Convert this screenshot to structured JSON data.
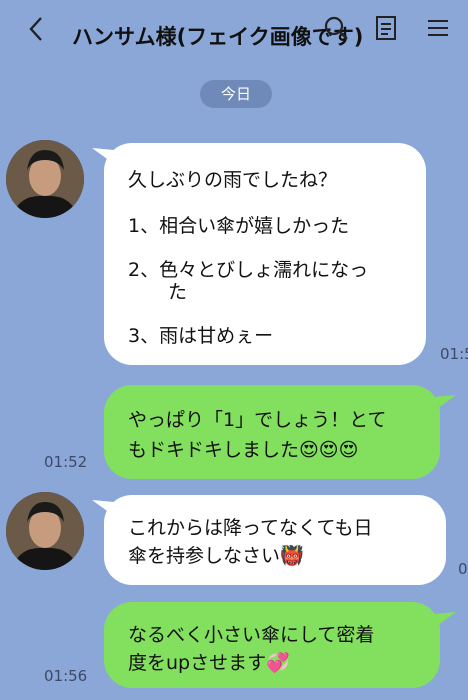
{
  "header": {
    "title": "ハンサム様(フェイク画像です)",
    "back_icon": "chevron-left-icon",
    "search_icon": "search-icon",
    "notes_icon": "notes-icon",
    "menu_icon": "menu-icon"
  },
  "date_label": "今日",
  "messages": [
    {
      "side": "left",
      "lines": [
        "久しぶりの雨でしたね？",
        "1、相合い傘が嬉しかった",
        "2、色々とびしょ濡れになっ",
        "た",
        "3、雨は甘めぇー"
      ],
      "time": "01:5"
    },
    {
      "side": "right",
      "lines": [
        "やっぱり「1」でしょう！とて",
        "もドキドキしました😍😍😍"
      ],
      "time": "01:52"
    },
    {
      "side": "left",
      "lines": [
        "これからは降ってなくても日",
        "傘を持参しなさい👹"
      ],
      "time": "0"
    },
    {
      "side": "right",
      "lines": [
        "なるべく小さい傘にして密着",
        "度をupさせます💞"
      ],
      "time": "01:56"
    }
  ],
  "colors": {
    "background": "#8ba7d8",
    "sent_bubble": "#83e05f",
    "received_bubble": "#ffffff",
    "date_pill": "#6f89b8"
  }
}
